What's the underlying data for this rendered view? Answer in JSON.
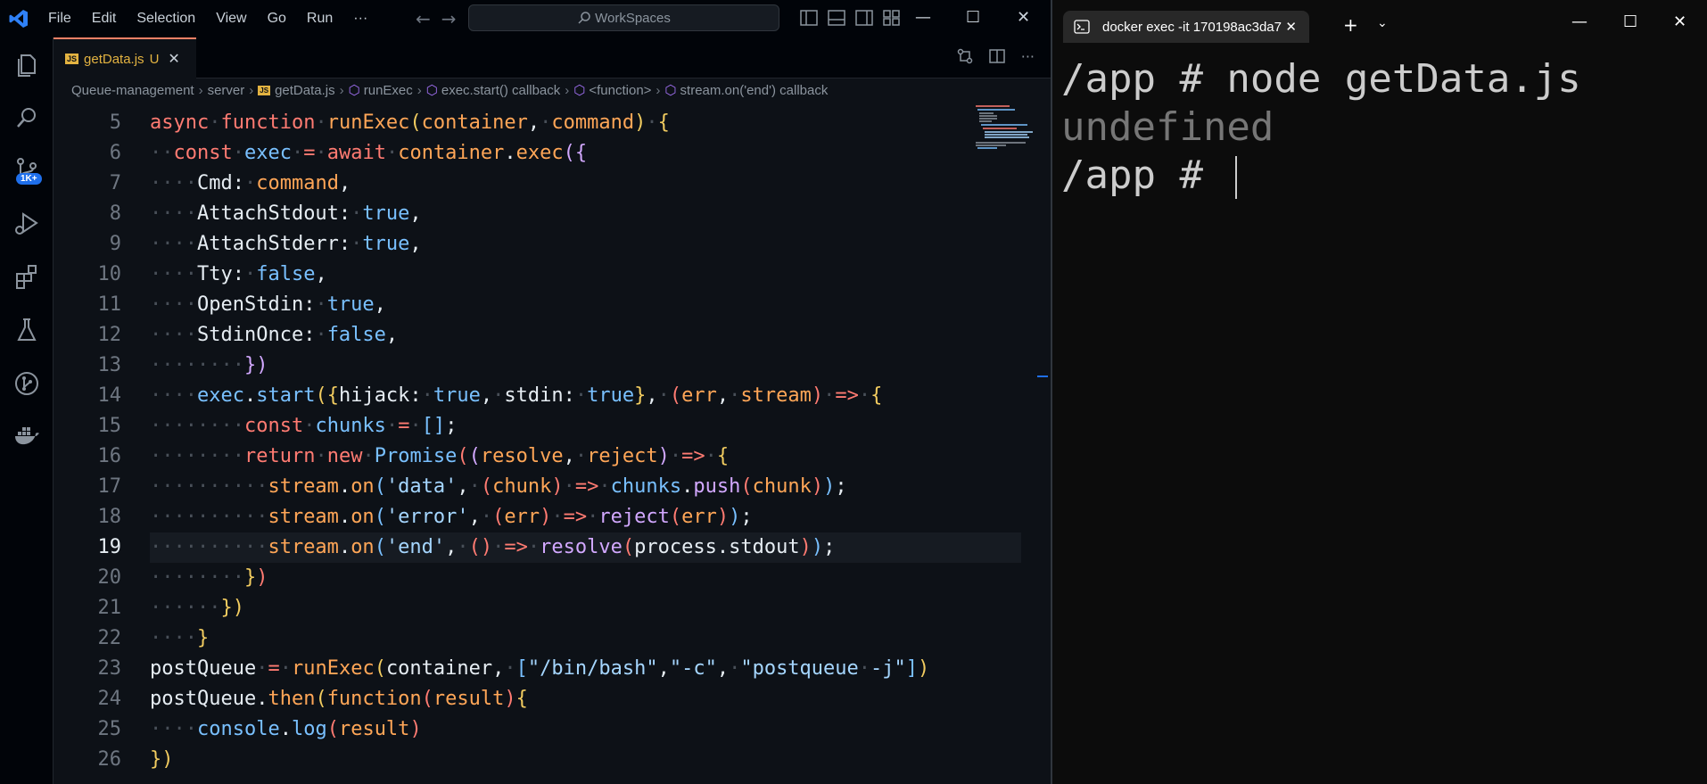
{
  "titlebar": {
    "menu": [
      "File",
      "Edit",
      "Selection",
      "View",
      "Go",
      "Run",
      "···"
    ],
    "search": "WorkSpaces"
  },
  "activity": {
    "badge": "1K+"
  },
  "tab": {
    "label": "getData.js",
    "status": "U",
    "icon_text": "JS"
  },
  "breadcrumb": [
    "Queue-management",
    "server",
    "getData.js",
    "runExec",
    "exec.start() callback",
    "<function>",
    "stream.on('end') callback"
  ],
  "editor": {
    "current_line": 19,
    "line_numbers": [
      "5",
      "6",
      "7",
      "8",
      "9",
      "10",
      "11",
      "12",
      "13",
      "14",
      "15",
      "16",
      "17",
      "18",
      "19",
      "20",
      "21",
      "22",
      "23",
      "24",
      "25",
      "26"
    ]
  },
  "terminal": {
    "tab_title": "docker  exec -it 170198ac3da7",
    "lines": [
      "/app # node getData.js",
      "undefined",
      "/app # "
    ]
  },
  "colors": {
    "accent": "#f78166",
    "keyword": "#ff7b72",
    "string": "#a5d6ff",
    "badge": "#1f6feb"
  }
}
